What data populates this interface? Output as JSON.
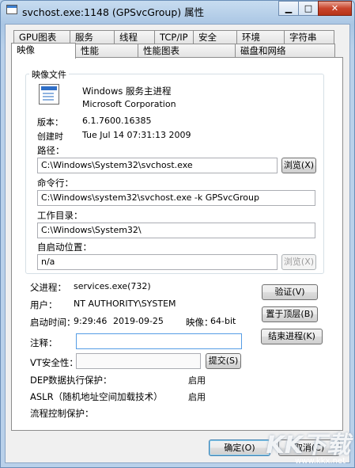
{
  "window": {
    "title": "svchost.exe:1148 (GPSvcGroup) 属性",
    "controls": {
      "minimize": "▁",
      "maximize": "□",
      "close": "✕"
    }
  },
  "tabs_row1": [
    "GPU图表",
    "服务",
    "线程",
    "TCP/IP",
    "安全",
    "环境",
    "字符串"
  ],
  "tabs_row2": [
    "映像",
    "性能",
    "性能图表",
    "磁盘和网络"
  ],
  "image_group": {
    "title": "映像文件",
    "description": "Windows 服务主进程",
    "company": "Microsoft Corporation",
    "version_label": "版本：",
    "version": "6.1.7600.16385",
    "created_label": "创建时",
    "created": "Tue Jul 14 07:31:13 2009",
    "path_label": "路径：",
    "path": "C:\\Windows\\System32\\svchost.exe",
    "browse_label": "浏览(X)",
    "cmdline_label": "命令行：",
    "cmdline": "C:\\Windows\\system32\\svchost.exe -k GPSvcGroup",
    "workdir_label": "工作目录：",
    "workdir": "C:\\Windows\\System32\\",
    "autostart_label": "自启动位置：",
    "autostart": "n/a",
    "browse2_label": "浏览(X)"
  },
  "process": {
    "parent_label": "父进程：",
    "parent": "services.exe(732)",
    "user_label": "用户：",
    "user": "NT AUTHORITY\\SYSTEM",
    "start_label": "启动时间：",
    "start_time": "9:29:46",
    "start_date": "2019-09-25",
    "image_label": "映像：",
    "image_bits": "64-bit",
    "comment_label": "注释：",
    "comment": "",
    "vt_label": "VT安全性：",
    "vt_value": "",
    "dep_label": "DEP数据执行保护：",
    "dep_value": "启用",
    "aslr_label": "ASLR（随机地址空间加载技术）",
    "aslr_value": "启用",
    "cfg_label": "流程控制保护：",
    "cfg_value": ""
  },
  "buttons": {
    "verify": "验证(V)",
    "bring_front": "置于顶层(B)",
    "kill": "结束进程(K)",
    "submit": "提交(S)",
    "ok": "确定(O)",
    "cancel": "取消(C)"
  },
  "watermark": {
    "logo": "KK下载",
    "site": "www.kkx.net"
  }
}
